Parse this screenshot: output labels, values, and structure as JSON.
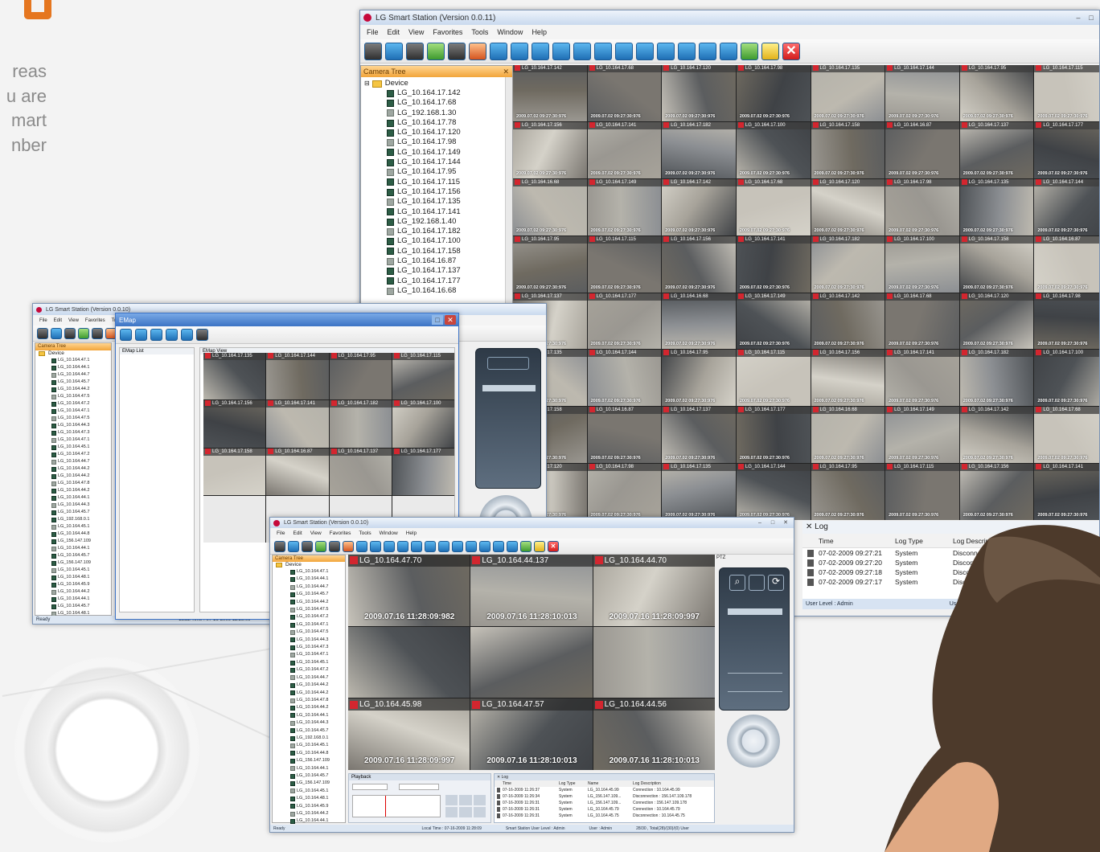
{
  "side_text": [
    "reas",
    "u are",
    "mart",
    "nber"
  ],
  "main_window": {
    "title": "LG Smart Station (Version 0.0.11)",
    "menu": [
      "File",
      "Edit",
      "View",
      "Favorites",
      "Tools",
      "Window",
      "Help"
    ],
    "camera_tree_title": "Camera Tree",
    "tree_root": "Device",
    "tree_items": [
      "LG_10.164.17.142",
      "LG_10.164.17.68",
      "LG_192.168.1.30",
      "LG_10.164.17.78",
      "LG_10.164.17.120",
      "LG_10.164.17.98",
      "LG_10.164.17.149",
      "LG_10.164.17.144",
      "LG_10.164.17.95",
      "LG_10.164.17.115",
      "LG_10.164.17.156",
      "LG_10.164.17.135",
      "LG_10.164.17.141",
      "LG_192.168.1.40",
      "LG_10.164.17.182",
      "LG_10.164.17.100",
      "LG_10.164.17.158",
      "LG_10.164.16.87",
      "LG_10.164.17.137",
      "LG_10.164.17.177",
      "LG_10.164.16.68"
    ],
    "grid_labels": [
      "LG_10.164.17.142",
      "LG_10.164.17.68",
      "LG_10.164.17.120",
      "LG_10.164.17.98",
      "LG_10.164.17.135",
      "LG_10.164.17.144",
      "LG_10.164.17.95",
      "LG_10.164.17.115",
      "LG_10.164.17.156",
      "LG_10.164.17.141",
      "LG_10.164.17.182",
      "LG_10.164.17.100",
      "LG_10.164.17.158",
      "LG_10.164.16.87",
      "LG_10.164.17.137",
      "LG_10.164.17.177",
      "LG_10.164.16.68",
      "LG_10.164.17.149"
    ],
    "grid_timestamp": "2009.07.02 09:27:30:976",
    "log": {
      "title": "Log",
      "headers": [
        "Time",
        "Log Type",
        "Log Description"
      ],
      "rows": [
        [
          "07-02-2009 09:27:21",
          "System",
          "Disconnection"
        ],
        [
          "07-02-2009 09:27:20",
          "System",
          "Disconnection"
        ],
        [
          "07-02-2009 09:27:18",
          "System",
          "Disconnection"
        ],
        [
          "07-02-2009 09:27:17",
          "System",
          "Disconnection"
        ]
      ]
    },
    "status_left": "User Level : Admin",
    "status_right": "User : Admin"
  },
  "left_window": {
    "title": "LG Smart Station (Version 0.0.10)",
    "tree_title": "Camera Tree",
    "tree_root": "Device",
    "dialog_title": "EMap",
    "emap_list": "EMap List",
    "emap_view": "EMap View",
    "tree_items": [
      "LG_10.164.47.1",
      "LG_10.164.44.1",
      "LG_10.164.44.7",
      "LG_10.164.45.7",
      "LG_10.164.44.2",
      "LG_10.164.47.5",
      "LG_10.164.47.2",
      "LG_10.164.47.1",
      "LG_10.164.47.5",
      "LG_10.164.44.3",
      "LG_10.164.47.3",
      "LG_10.164.47.1",
      "LG_10.164.45.1",
      "LG_10.164.47.2",
      "LG_10.164.44.7",
      "LG_10.164.44.2",
      "LG_10.164.44.2",
      "LG_10.164.47.8",
      "LG_10.164.44.2",
      "LG_10.164.44.1",
      "LG_10.164.44.3",
      "LG_10.164.45.7",
      "LG_192.168.0.1",
      "LG_10.164.45.1",
      "LG_10.164.44.8",
      "LG_156.147.109",
      "LG_10.164.44.1",
      "LG_10.164.45.7",
      "LG_156.147.109",
      "LG_10.164.45.1",
      "LG_10.164.48.1",
      "LG_10.164.45.9",
      "LG_10.164.44.2",
      "LG_10.164.44.1",
      "LG_10.164.45.7",
      "LG_10.164.48.1"
    ],
    "status": "Ready",
    "status_time": "Local Time : 07-16-2009 11:28:09"
  },
  "front_window": {
    "title": "LG Smart Station (Version 0.0.10)",
    "menu": [
      "File",
      "Edit",
      "View",
      "Favorites",
      "Tools",
      "Window",
      "Help"
    ],
    "tree_title": "Camera Tree",
    "tree_root": "Device",
    "tree_items": [
      "LG_10.164.47.1",
      "LG_10.164.44.1",
      "LG_10.164.44.7",
      "LG_10.164.45.7",
      "LG_10.164.44.2",
      "LG_10.164.47.5",
      "LG_10.164.47.2",
      "LG_10.164.47.1",
      "LG_10.164.47.5",
      "LG_10.164.44.3",
      "LG_10.164.47.3",
      "LG_10.164.47.1",
      "LG_10.164.45.1",
      "LG_10.164.47.2",
      "LG_10.164.44.7",
      "LG_10.164.44.2",
      "LG_10.164.44.2",
      "LG_10.164.47.8",
      "LG_10.164.44.2",
      "LG_10.164.44.1",
      "LG_10.164.44.3",
      "LG_10.164.45.7",
      "LG_192.168.0.1",
      "LG_10.164.45.1",
      "LG_10.164.44.8",
      "LG_156.147.109",
      "LG_10.164.44.1",
      "LG_10.164.45.7",
      "LG_156.147.109",
      "LG_10.164.45.1",
      "LG_10.164.48.1",
      "LG_10.164.45.9",
      "LG_10.164.44.2",
      "LG_10.164.44.1"
    ],
    "cams": [
      {
        "label": "LG_10.164.47.70",
        "ts": "2009.07.16 11:28:09:982"
      },
      {
        "label": "LG_10.164.44.137",
        "ts": "2009.07.16 11:28:10:013"
      },
      {
        "label": "LG_10.164.44.70",
        "ts": "2009.07.16 11:28:09:997"
      },
      {
        "label": "",
        "ts": ""
      },
      {
        "label": "",
        "ts": ""
      },
      {
        "label": "",
        "ts": ""
      },
      {
        "label": "LG_10.164.45.98",
        "ts": "2009.07.16 11:28:09:997"
      },
      {
        "label": "LG_10.164.47.57",
        "ts": "2009.07.16 11:28:10:013"
      },
      {
        "label": "LG_10.164.44.56",
        "ts": "2009.07.16 11:28:10:013"
      }
    ],
    "ptz_title": "PTZ",
    "playback_title": "Playback",
    "log_title": "Log",
    "log_headers": [
      "Time",
      "Log Type",
      "Name",
      "Log Description"
    ],
    "log_rows": [
      [
        "07-16-2009 11:26:37",
        "System",
        "LG_10.164.45.99",
        "Connection : 10.164.45.99"
      ],
      [
        "07-16-2009 11:26:34",
        "System",
        "LG_156.147.109...",
        "Disconnection : 156.147.109.178"
      ],
      [
        "07-16-2009 11:26:31",
        "System",
        "LG_156.147.109...",
        "Connection : 156.147.109.178"
      ],
      [
        "07-16-2009 11:26:31",
        "System",
        "LG_10.164.45.79",
        "Connection : 10.164.45.79"
      ],
      [
        "07-16-2009 11:26:31",
        "System",
        "LG_10.164.45.75",
        "Disconnection : 10.164.45.75"
      ]
    ],
    "status": "Ready",
    "status_items": [
      "Local Time : 07-16-2009 11:28:09",
      "Smart Station User Level : Admin",
      "User : Admin",
      "28/30 , Total(28)/(30)/(0) User"
    ]
  }
}
